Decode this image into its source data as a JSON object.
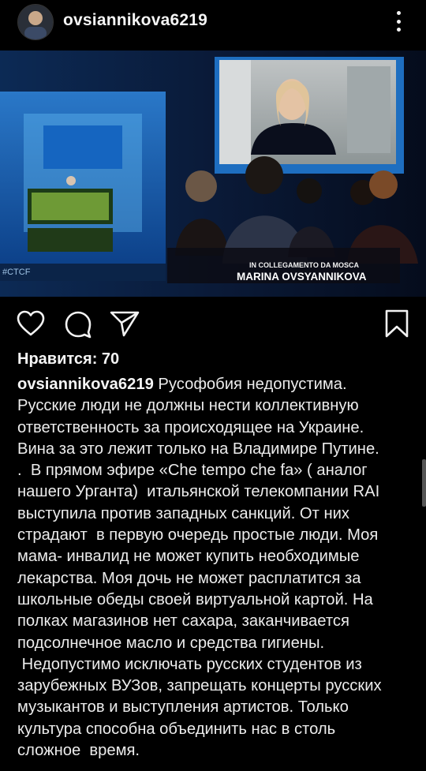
{
  "post": {
    "username": "ovsiannikova6219",
    "likes_label": "Нравится: 70",
    "caption_author": "ovsiannikova6219",
    "caption_text": " Русофобия недопустима.\nРусские люди не должны нести коллективную\nответственность за происходящее на Украине.\nВина за это лежит только на Владимире Путине.\n.  В прямом эфире «Che tempo che fa» ( аналог\nнашего Урганта)  итальянской телекомпании RAI\nвыступила против западных санкций. От них\nстрадают  в первую очередь простые люди. Моя\nмама- инвалид не может купить необходимые\nлекарства. Моя дочь не может расплатится за\nшкольные обеды своей виртуальной картой. На\nполках магазинов нет сахара, заканчивается\nподсолнечное масло и средства гигиены.\n Недопустимо исключать русских студентов из\nзарубежных ВУЗов, запрещать концерты русских\nмузыкантов и выступления артистов. Только\nкультура способна объединить нас в столь\nсложное  время."
  },
  "photo": {
    "caption_line1": "IN COLLEGAMENTO DA MOSCA",
    "caption_line2": "MARINA OVSYANNIKOVA",
    "logo": "#CTCF"
  },
  "icons": {
    "more": "more-vertical-icon",
    "like": "heart-icon",
    "comment": "comment-icon",
    "share": "send-icon",
    "save": "bookmark-icon"
  }
}
